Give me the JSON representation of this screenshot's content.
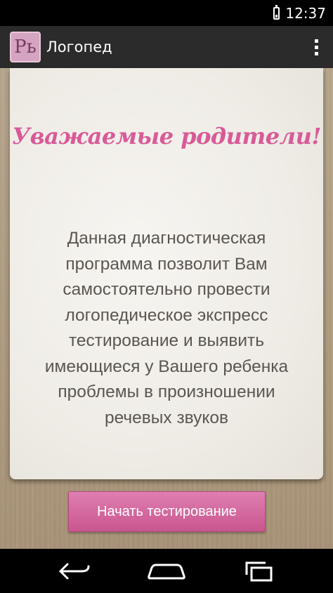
{
  "status_bar": {
    "time": "12:37",
    "battery_icon": "battery-icon"
  },
  "action_bar": {
    "app_icon_text": "Рь",
    "title": "Логопед",
    "overflow_icon": "overflow-menu-icon"
  },
  "main": {
    "heading": "Уважаемые родители!",
    "description_lines": [
      "Данная диагностическая",
      "программа позволит Вам",
      "самостоятельно провести",
      "логопедическое экспресс",
      "тестирование и выявить",
      "имеющиеся у Вашего ребенка",
      "проблемы в произношении",
      "речевых звуков"
    ],
    "start_button_label": "Начать тестирование"
  },
  "nav_bar": {
    "icons": [
      "back-icon",
      "home-icon",
      "recents-icon"
    ]
  },
  "colors": {
    "accent": "#d95a98",
    "button": "#d46aa0",
    "text": "#5a5550",
    "background_wood": "#b09c82"
  }
}
